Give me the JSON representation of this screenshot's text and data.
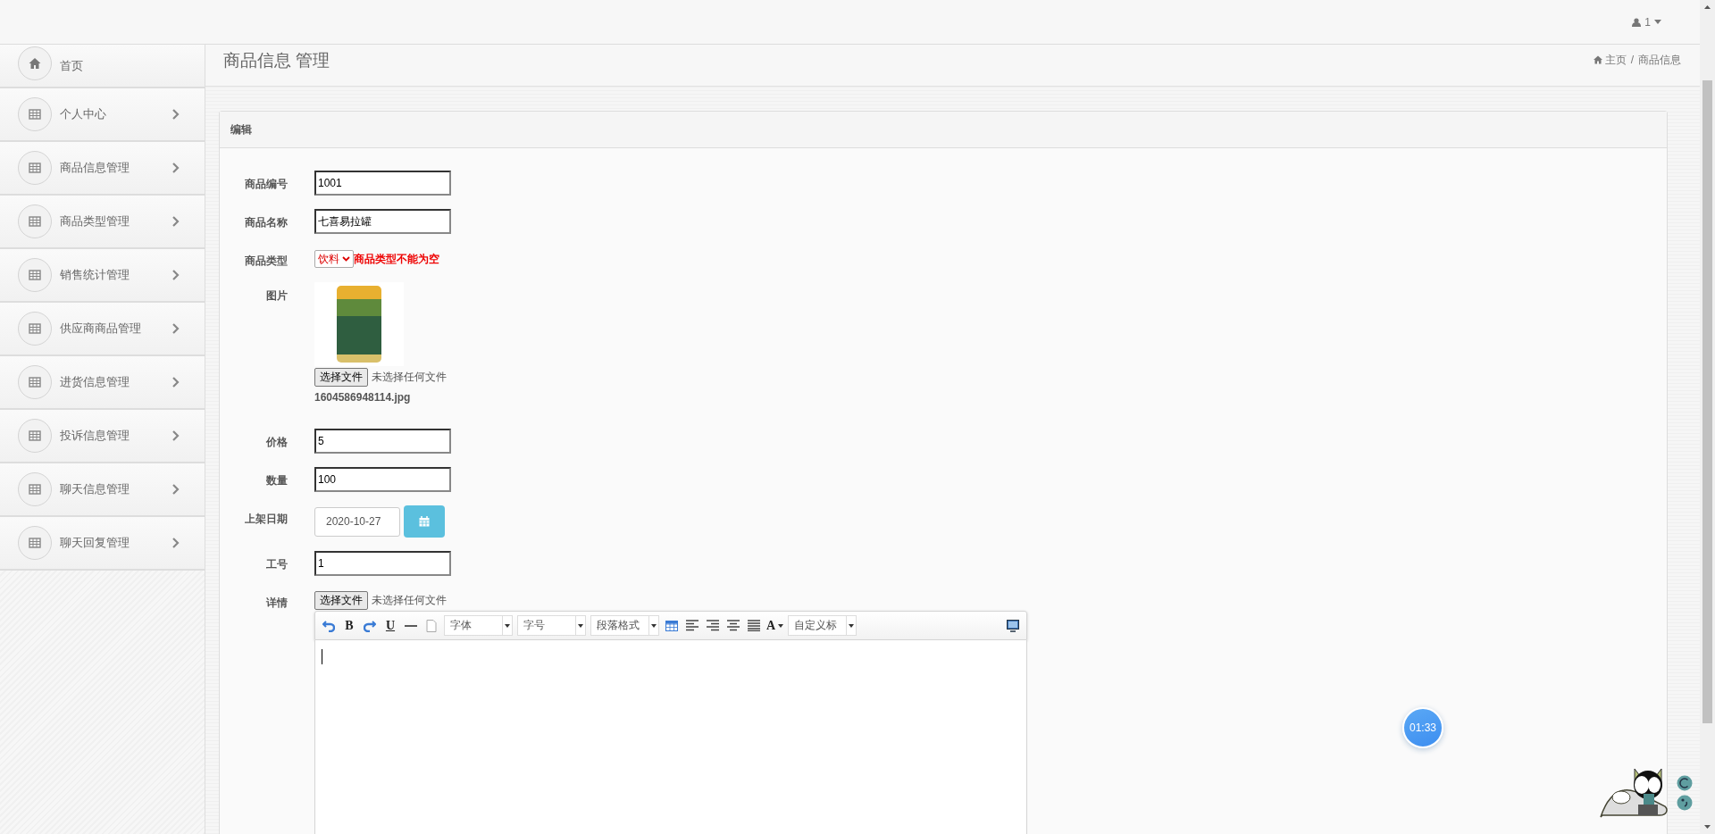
{
  "topbar": {
    "user": "1"
  },
  "sidebar": {
    "items": [
      {
        "label": "首页",
        "kind": "home"
      },
      {
        "label": "个人中心",
        "kind": "menu"
      },
      {
        "label": "商品信息管理",
        "kind": "menu"
      },
      {
        "label": "商品类型管理",
        "kind": "menu"
      },
      {
        "label": "销售统计管理",
        "kind": "menu"
      },
      {
        "label": "供应商商品管理",
        "kind": "menu"
      },
      {
        "label": "进货信息管理",
        "kind": "menu"
      },
      {
        "label": "投诉信息管理",
        "kind": "menu"
      },
      {
        "label": "聊天信息管理",
        "kind": "menu"
      },
      {
        "label": "聊天回复管理",
        "kind": "menu"
      }
    ]
  },
  "header": {
    "title": "商品信息 管理",
    "breadcrumb": [
      {
        "label": "主页"
      },
      {
        "label": "商品信息"
      }
    ],
    "separator": "/"
  },
  "panel": {
    "title": "编辑",
    "fields": [
      {
        "kind": "text",
        "label": "商品编号",
        "value": "1001"
      },
      {
        "kind": "text",
        "label": "商品名称",
        "value": "七喜易拉罐"
      },
      {
        "kind": "select",
        "label": "商品类型",
        "value": "饮料",
        "error": "商品类型不能为空"
      },
      {
        "kind": "image",
        "label": "图片",
        "button": "选择文件",
        "file_status": "未选择任何文件",
        "filename": "1604586948114.jpg"
      },
      {
        "kind": "text",
        "label": "价格",
        "value": "5"
      },
      {
        "kind": "text",
        "label": "数量",
        "value": "100"
      },
      {
        "kind": "date",
        "label": "上架日期",
        "value": "2020-10-27"
      },
      {
        "kind": "text",
        "label": "工号",
        "value": "1"
      },
      {
        "kind": "editor",
        "label": "详情",
        "button": "选择文件",
        "file_status": "未选择任何文件",
        "toolbar": [
          {
            "kind": "undo"
          },
          {
            "kind": "bold",
            "glyph": "B"
          },
          {
            "kind": "redo"
          },
          {
            "kind": "underline",
            "glyph": "U"
          },
          {
            "kind": "rule"
          },
          {
            "kind": "page"
          },
          {
            "kind": "dropdown",
            "label": "字体"
          },
          {
            "kind": "dropdown",
            "label": "字号"
          },
          {
            "kind": "dropdown",
            "label": "段落格式"
          },
          {
            "kind": "table"
          },
          {
            "kind": "align-left"
          },
          {
            "kind": "align-right"
          },
          {
            "kind": "align-center"
          },
          {
            "kind": "justify"
          },
          {
            "kind": "font-color",
            "glyph": "A"
          },
          {
            "kind": "dropdown",
            "label": "自定义标"
          },
          {
            "kind": "preview"
          }
        ]
      }
    ]
  },
  "timer": {
    "time": "01:33"
  }
}
